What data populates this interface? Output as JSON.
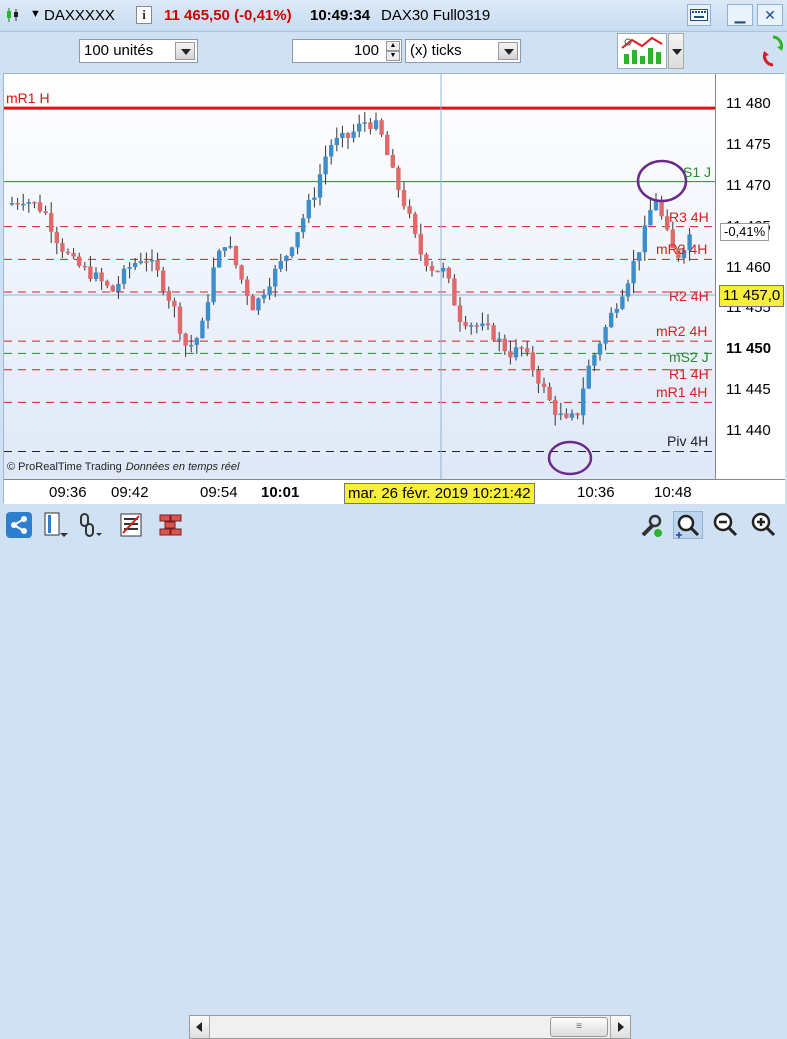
{
  "title_bar": {
    "symbol": "DAXXXXX",
    "info_label": "i",
    "price_change": "11 465,50 (-0,41%)",
    "time": "10:49:34",
    "instrument": "DAX30 Full0319",
    "keyboard_icon": "keyboard-icon",
    "close_label": "✕"
  },
  "toolbar": {
    "units": "100 unités",
    "tick_count": "100",
    "tick_mode": "(x) ticks"
  },
  "chart": {
    "y_ticks": [
      "11 480",
      "11 475",
      "11 470",
      "11 465",
      "11 460",
      "11 455",
      "11 450",
      "11 445",
      "11 440"
    ],
    "last_price": "11 457,0",
    "change_pct": "-0,41%",
    "x_ticks": [
      "09:36",
      "09:42",
      "09:54",
      "10:01",
      "10:36",
      "10:48"
    ],
    "cursor_date": "mar. 26 févr. 2019 10:21:42",
    "copyright": "© ProRealTime Trading",
    "realtime_note": "Données en temps réel",
    "levels": [
      {
        "label": "mR1 H",
        "price": 11479.5,
        "color": "#e01010",
        "style": "solid"
      },
      {
        "label": "S1 J",
        "price": 11470.5,
        "color": "#2a8a2a",
        "style": "solid"
      },
      {
        "label": "R3 4H",
        "price": 11465.0,
        "color": "#d42020",
        "style": "dashed"
      },
      {
        "label": "mR3 4H",
        "price": 11461.0,
        "color": "#d42020",
        "style": "dashed"
      },
      {
        "label": "R2 4H",
        "price": 11457.0,
        "color": "#d42020",
        "style": "dashed"
      },
      {
        "label": "mR2 4H",
        "price": 11451.0,
        "color": "#d42020",
        "style": "dashed"
      },
      {
        "label": "mS2 J",
        "price": 11449.5,
        "color": "#2a8a2a",
        "style": "dashed"
      },
      {
        "label": "R1 4H",
        "price": 11447.5,
        "color": "#d42020",
        "style": "dashed"
      },
      {
        "label": "mR1 4H",
        "price": 11443.5,
        "color": "#d42020",
        "style": "dashed"
      },
      {
        "label": "Piv 4H",
        "price": 11437.5,
        "color": "#222222",
        "style": "dashed"
      }
    ],
    "colors": {
      "up": "#3d8fcc",
      "down": "#e06a6a",
      "background_top": "#ffffff",
      "background_bottom": "#dfe8f8"
    }
  },
  "bottom_bar": {
    "icons": [
      "share-icon",
      "layout-icon",
      "link-icon",
      "list-icon",
      "bricks-icon",
      "settings-wrench-icon",
      "zoom-fit-icon",
      "zoom-out-icon",
      "zoom-in-icon"
    ]
  }
}
